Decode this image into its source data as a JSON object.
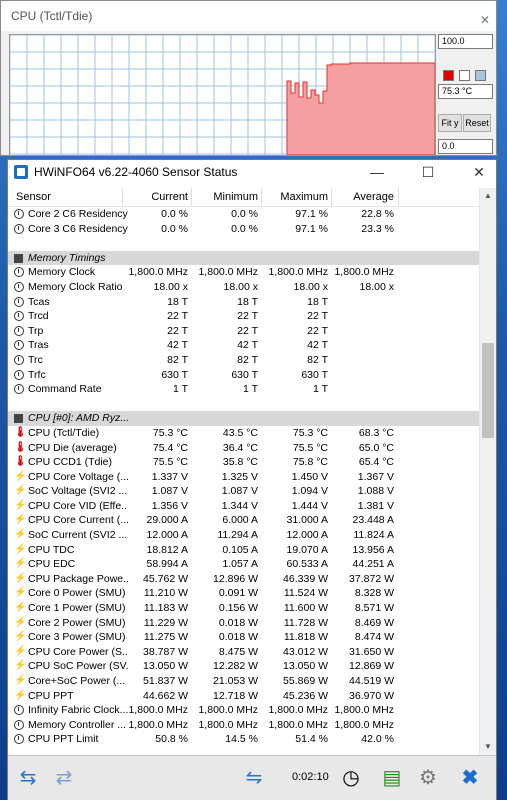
{
  "graph": {
    "title": "CPU (Tctl/Tdie)",
    "max_value": "100.0",
    "current_value": "75.3 °C",
    "min_value": "0.0",
    "fit_y_label": "Fit y",
    "reset_label": "Reset"
  },
  "window": {
    "title": "HWiNFO64 v6.22-4060 Sensor Status",
    "minimize": "—",
    "maximize": "☐",
    "close": "✕"
  },
  "columns": {
    "sensor": "Sensor",
    "current": "Current",
    "minimum": "Minimum",
    "maximum": "Maximum",
    "average": "Average"
  },
  "rows": [
    {
      "icon": "clock",
      "name": "Core 2 C6 Residency",
      "cur": "0.0 %",
      "min": "0.0 %",
      "max": "97.1 %",
      "avg": "22.8 %"
    },
    {
      "icon": "clock",
      "name": "Core 3 C6 Residency",
      "cur": "0.0 %",
      "min": "0.0 %",
      "max": "97.1 %",
      "avg": "23.3 %"
    },
    {
      "type": "blank"
    },
    {
      "type": "group",
      "icon": "chip",
      "name": "Memory Timings"
    },
    {
      "icon": "clock",
      "name": "Memory Clock",
      "cur": "1,800.0 MHz",
      "min": "1,800.0 MHz",
      "max": "1,800.0 MHz",
      "avg": "1,800.0 MHz"
    },
    {
      "icon": "clock",
      "name": "Memory Clock Ratio",
      "cur": "18.00 x",
      "min": "18.00 x",
      "max": "18.00 x",
      "avg": "18.00 x"
    },
    {
      "icon": "clock",
      "name": "Tcas",
      "cur": "18 T",
      "min": "18 T",
      "max": "18 T",
      "avg": ""
    },
    {
      "icon": "clock",
      "name": "Trcd",
      "cur": "22 T",
      "min": "22 T",
      "max": "22 T",
      "avg": ""
    },
    {
      "icon": "clock",
      "name": "Trp",
      "cur": "22 T",
      "min": "22 T",
      "max": "22 T",
      "avg": ""
    },
    {
      "icon": "clock",
      "name": "Tras",
      "cur": "42 T",
      "min": "42 T",
      "max": "42 T",
      "avg": ""
    },
    {
      "icon": "clock",
      "name": "Trc",
      "cur": "82 T",
      "min": "82 T",
      "max": "82 T",
      "avg": ""
    },
    {
      "icon": "clock",
      "name": "Trfc",
      "cur": "630 T",
      "min": "630 T",
      "max": "630 T",
      "avg": ""
    },
    {
      "icon": "clock",
      "name": "Command Rate",
      "cur": "1 T",
      "min": "1 T",
      "max": "1 T",
      "avg": ""
    },
    {
      "type": "blank"
    },
    {
      "type": "group",
      "icon": "chip",
      "name": "CPU [#0]: AMD Ryz..."
    },
    {
      "icon": "therm",
      "name": "CPU (Tctl/Tdie)",
      "cur": "75.3 °C",
      "min": "43.5 °C",
      "max": "75.3 °C",
      "avg": "68.3 °C"
    },
    {
      "icon": "therm",
      "name": "CPU Die (average)",
      "cur": "75.4 °C",
      "min": "36.4 °C",
      "max": "75.5 °C",
      "avg": "65.0 °C"
    },
    {
      "icon": "therm",
      "name": "CPU CCD1 (Tdie)",
      "cur": "75.5 °C",
      "min": "35.8 °C",
      "max": "75.8 °C",
      "avg": "65.4 °C"
    },
    {
      "icon": "bolt",
      "name": "CPU Core Voltage (...",
      "cur": "1.337 V",
      "min": "1.325 V",
      "max": "1.450 V",
      "avg": "1.367 V"
    },
    {
      "icon": "bolt",
      "name": "SoC Voltage (SVI2 ...",
      "cur": "1.087 V",
      "min": "1.087 V",
      "max": "1.094 V",
      "avg": "1.088 V"
    },
    {
      "icon": "bolt",
      "name": "CPU Core VID (Effe...",
      "cur": "1.356 V",
      "min": "1.344 V",
      "max": "1.444 V",
      "avg": "1.381 V"
    },
    {
      "icon": "bolt",
      "name": "CPU Core Current (...",
      "cur": "29.000 A",
      "min": "6.000 A",
      "max": "31.000 A",
      "avg": "23.448 A"
    },
    {
      "icon": "bolt",
      "name": "SoC Current (SVI2 ...",
      "cur": "12.000 A",
      "min": "11.294 A",
      "max": "12.000 A",
      "avg": "11.824 A"
    },
    {
      "icon": "bolt",
      "name": "CPU TDC",
      "cur": "18.812 A",
      "min": "0.105 A",
      "max": "19.070 A",
      "avg": "13.956 A"
    },
    {
      "icon": "bolt",
      "name": "CPU EDC",
      "cur": "58.994 A",
      "min": "1.057 A",
      "max": "60.533 A",
      "avg": "44.251 A"
    },
    {
      "icon": "bolt",
      "name": "CPU Package Powe...",
      "cur": "45.762 W",
      "min": "12.896 W",
      "max": "46.339 W",
      "avg": "37.872 W"
    },
    {
      "icon": "bolt",
      "name": "Core 0 Power (SMU)",
      "cur": "11.210 W",
      "min": "0.091 W",
      "max": "11.524 W",
      "avg": "8.328 W"
    },
    {
      "icon": "bolt",
      "name": "Core 1 Power (SMU)",
      "cur": "11.183 W",
      "min": "0.156 W",
      "max": "11.600 W",
      "avg": "8.571 W"
    },
    {
      "icon": "bolt",
      "name": "Core 2 Power (SMU)",
      "cur": "11.229 W",
      "min": "0.018 W",
      "max": "11.728 W",
      "avg": "8.469 W"
    },
    {
      "icon": "bolt",
      "name": "Core 3 Power (SMU)",
      "cur": "11.275 W",
      "min": "0.018 W",
      "max": "11.818 W",
      "avg": "8.474 W"
    },
    {
      "icon": "bolt",
      "name": "CPU Core Power (S...",
      "cur": "38.787 W",
      "min": "8.475 W",
      "max": "43.012 W",
      "avg": "31.650 W"
    },
    {
      "icon": "bolt",
      "name": "CPU SoC Power (SV...",
      "cur": "13.050 W",
      "min": "12.282 W",
      "max": "13.050 W",
      "avg": "12.869 W"
    },
    {
      "icon": "bolt",
      "name": "Core+SoC Power (...",
      "cur": "51.837 W",
      "min": "21.053 W",
      "max": "55.869 W",
      "avg": "44.519 W"
    },
    {
      "icon": "bolt",
      "name": "CPU PPT",
      "cur": "44.662 W",
      "min": "12.718 W",
      "max": "45.236 W",
      "avg": "36.970 W"
    },
    {
      "icon": "clock",
      "name": "Infinity Fabric Clock...",
      "cur": "1,800.0 MHz",
      "min": "1,800.0 MHz",
      "max": "1,800.0 MHz",
      "avg": "1,800.0 MHz"
    },
    {
      "icon": "clock",
      "name": "Memory Controller ...",
      "cur": "1,800.0 MHz",
      "min": "1,800.0 MHz",
      "max": "1,800.0 MHz",
      "avg": "1,800.0 MHz"
    },
    {
      "icon": "clock",
      "name": "CPU PPT Limit",
      "cur": "50.8 %",
      "min": "14.5 %",
      "max": "51.4 %",
      "avg": "42.0 %"
    }
  ],
  "toolbar": {
    "timer": "0:02:10"
  },
  "colors": {
    "graph_fill": "#f4a0a0",
    "graph_line": "#e03030",
    "grid": "#9fc3e0",
    "group_bg": "#d8d8d8"
  }
}
